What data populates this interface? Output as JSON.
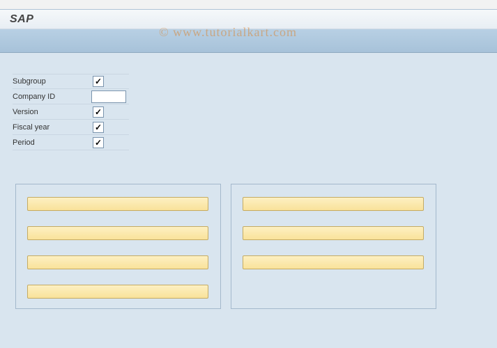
{
  "header": {
    "title": "SAP"
  },
  "form": {
    "fields": [
      {
        "label": "Subgroup",
        "type": "checkbox",
        "checked": true
      },
      {
        "label": "Company ID",
        "type": "text",
        "value": ""
      },
      {
        "label": "Version",
        "type": "checkbox",
        "checked": true
      },
      {
        "label": "Fiscal year",
        "type": "checkbox",
        "checked": true
      },
      {
        "label": "Period",
        "type": "checkbox",
        "checked": true
      }
    ]
  },
  "panels": {
    "left": {
      "button_count": 4
    },
    "right": {
      "button_count": 3
    }
  },
  "watermark": "© www.tutorialkart.com"
}
